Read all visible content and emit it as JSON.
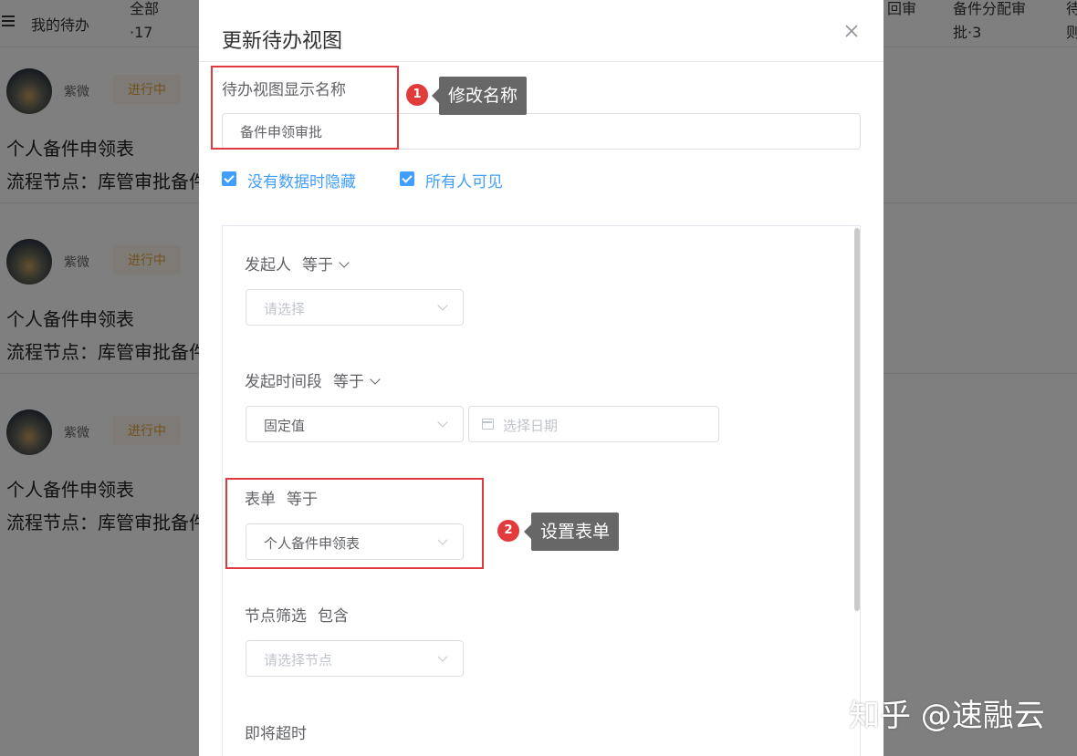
{
  "background": {
    "title": "我的待办",
    "tabs": [
      {
        "label": "全部",
        "count": "·17"
      },
      {
        "label": "回审",
        "count": ""
      },
      {
        "label": "备件分配审",
        "count": "批·3"
      },
      {
        "label": "待",
        "count": "则"
      }
    ],
    "items": [
      {
        "user": "紫微",
        "status": "进行中",
        "form": "个人备件申领表",
        "node": "流程节点：库管审批备件"
      },
      {
        "user": "紫微",
        "status": "进行中",
        "form": "个人备件申领表",
        "node": "流程节点：库管审批备件"
      },
      {
        "user": "紫微",
        "status": "进行中",
        "form": "个人备件申领表",
        "node": "流程节点：库管审批备件"
      }
    ]
  },
  "dialog": {
    "title": "更新待办视图",
    "name_label": "待办视图显示名称",
    "name_value": "备件申领审批",
    "checkboxes": [
      {
        "label": "没有数据时隐藏",
        "checked": true
      },
      {
        "label": "所有人可见",
        "checked": true
      }
    ],
    "filters": {
      "initiator": {
        "label": "发起人",
        "op": "等于",
        "placeholder": "请选择"
      },
      "period": {
        "label": "发起时间段",
        "op": "等于",
        "mode": "固定值",
        "date_placeholder": "选择日期"
      },
      "form": {
        "label": "表单",
        "op": "等于",
        "value": "个人备件申领表"
      },
      "node": {
        "label": "节点筛选",
        "op": "包含",
        "placeholder": "请选择节点"
      },
      "timeout": {
        "label": "即将超时"
      }
    }
  },
  "annotations": [
    {
      "number": "1",
      "text": "修改名称"
    },
    {
      "number": "2",
      "text": "设置表单"
    }
  ],
  "watermark": "知乎 @速融云",
  "colors": {
    "accent": "#409eff",
    "annotation_red": "#e0393e",
    "status_orange": "#e6a23c"
  }
}
